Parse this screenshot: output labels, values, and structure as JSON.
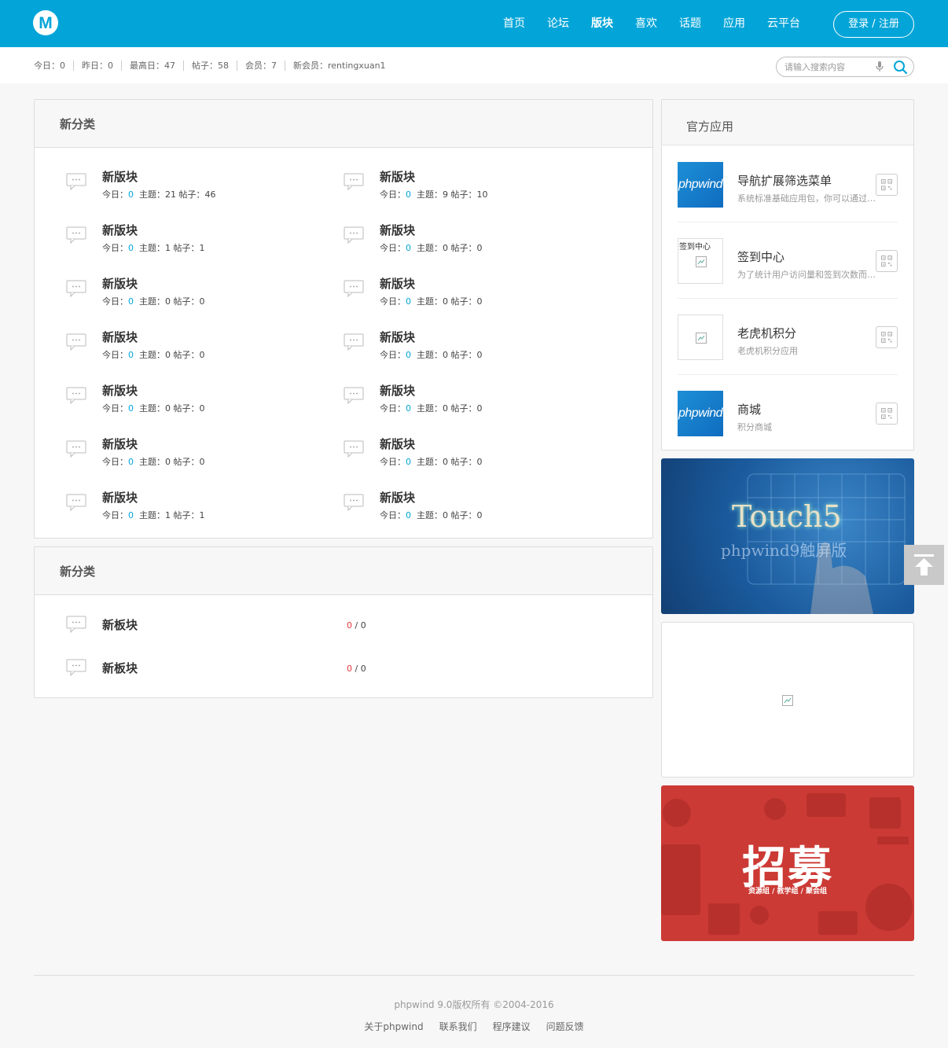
{
  "header": {
    "logo_letter": "M",
    "nav": [
      {
        "label": "首页"
      },
      {
        "label": "论坛"
      },
      {
        "label": "版块"
      },
      {
        "label": "喜欢"
      },
      {
        "label": "话题"
      },
      {
        "label": "应用"
      },
      {
        "label": "云平台"
      }
    ],
    "active_nav": "版块",
    "login_label": "登录 / 注册",
    "brand_color": "#03a5d8"
  },
  "stats": [
    "今日：0",
    "昨日：0",
    "最高日：47",
    "帖子：58",
    "会员：7",
    "新会员：rentingxuan1"
  ],
  "search": {
    "placeholder": "请输入搜索内容"
  },
  "category1": {
    "title": "新分类",
    "boards": [
      {
        "name": "新版块",
        "today": "0",
        "topics": "21",
        "posts": "46"
      },
      {
        "name": "新版块",
        "today": "0",
        "topics": "9",
        "posts": "10"
      },
      {
        "name": "新版块",
        "today": "0",
        "topics": "1",
        "posts": "1"
      },
      {
        "name": "新版块",
        "today": "0",
        "topics": "0",
        "posts": "0"
      },
      {
        "name": "新版块",
        "today": "0",
        "topics": "0",
        "posts": "0"
      },
      {
        "name": "新版块",
        "today": "0",
        "topics": "0",
        "posts": "0"
      },
      {
        "name": "新版块",
        "today": "0",
        "topics": "0",
        "posts": "0"
      },
      {
        "name": "新版块",
        "today": "0",
        "topics": "0",
        "posts": "0"
      },
      {
        "name": "新版块",
        "today": "0",
        "topics": "0",
        "posts": "0"
      },
      {
        "name": "新版块",
        "today": "0",
        "topics": "0",
        "posts": "0"
      },
      {
        "name": "新版块",
        "today": "0",
        "topics": "0",
        "posts": "0"
      },
      {
        "name": "新版块",
        "today": "0",
        "topics": "0",
        "posts": "0"
      },
      {
        "name": "新版块",
        "today": "0",
        "topics": "1",
        "posts": "1"
      },
      {
        "name": "新版块",
        "today": "0",
        "topics": "0",
        "posts": "0"
      }
    ],
    "labels": {
      "today": "今日：",
      "topics": "主题：",
      "posts": "帖子："
    }
  },
  "category2": {
    "title": "新分类",
    "boards": [
      {
        "name": "新板块",
        "today": "0",
        "total": "0"
      },
      {
        "name": "新板块",
        "today": "0",
        "total": "0"
      }
    ]
  },
  "sidebar": {
    "title": "官方应用",
    "apps": [
      {
        "title": "导航扩展筛选菜单",
        "desc": "系统标准基础应用包，你可以通过此应用包完成导航扩展",
        "thumb": "phpwind"
      },
      {
        "title": "签到中心",
        "desc": "为了统计用户访问量和签到次数而设计的应用",
        "thumb": "签到中心"
      },
      {
        "title": "老虎机积分",
        "desc": "老虎机积分应用",
        "thumb": ""
      },
      {
        "title": "商城",
        "desc": "积分商城",
        "thumb": "phpwind"
      }
    ],
    "banner1": {
      "big": "Touch5",
      "sub": "phpwind9触屏版"
    },
    "banner2": {},
    "banner3": {
      "big": "招募",
      "sub": "资源组 / 教学组 / 聚会组",
      "color": "#cc3a35"
    }
  },
  "footer": {
    "copyright": "phpwind 9.0版权所有 ©2004-2016",
    "links": [
      "关于phpwind",
      "联系我们",
      "程序建议",
      "问题反馈"
    ]
  }
}
